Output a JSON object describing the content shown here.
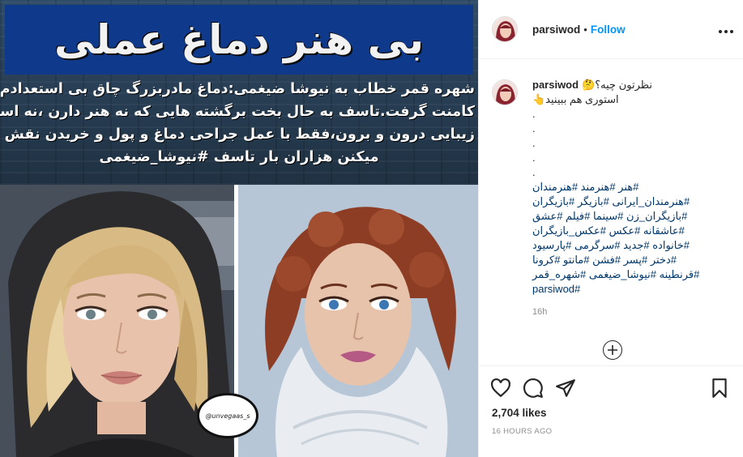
{
  "post_image": {
    "headline": "بی هنر دماغ عملی",
    "caption_lines": [
      "شهره قمر خطاب به نیوشا ضیغمی:دماغ مادربزرگ چاق بی استعدادم ده هزارتا",
      "کامنت گرفت.تاسف به حال بخت برگشته هایی که نه هنر دارن ،نه استعداد و نه",
      "زیبایی درون و برون،فقط با عمل جراحی دماغ و پول و خریدن نقش خودنمایی",
      "میکنن هزاران بار تاسف #نیوشا_ضیغمی"
    ],
    "stamp_text": "@unvegaas_s",
    "colors": {
      "headline_bg": "#0f3a8c",
      "headline_text": "#f2f2f2",
      "banner_bg": "#2a4158"
    }
  },
  "header": {
    "username": "parsiwod",
    "separator": "•",
    "follow_label": "Follow",
    "more_icon": "more-horizontal-icon"
  },
  "caption": {
    "username": "parsiwod",
    "line1": "نظرتون چیه؟🤔",
    "line2": "استوری هم ببینید👆",
    "dots": [
      ".",
      ".",
      ".",
      ".",
      "."
    ],
    "hashtag_lines": [
      "هنر #هنرمند #هنرمندان#",
      "هنرمندان_ایرانی #بازیگر #بازیگران#",
      "بازیگران_زن #سینما #فیلم #عشق#",
      "عاشقانه #عکس #عکس_بازیگران#",
      "خانواده #جدید #سرگرمی #پارسیود#",
      "دختر #پسر #فشن #مانتو #کرونا#",
      "قرنطینه #نیوشا_ضیغمی #شهره_قمر#",
      "parsiwod#"
    ],
    "age": "16h"
  },
  "add_comment_icon": "plus-circle-icon",
  "actions": {
    "icons": [
      "heart-icon",
      "comment-icon",
      "share-icon",
      "bookmark-icon"
    ],
    "likes": "2,704 likes",
    "timestamp": "16 HOURS AGO"
  },
  "colors": {
    "follow": "#0095f6",
    "hashtag": "#00376b",
    "muted": "#8e8e8e",
    "text": "#262626"
  }
}
